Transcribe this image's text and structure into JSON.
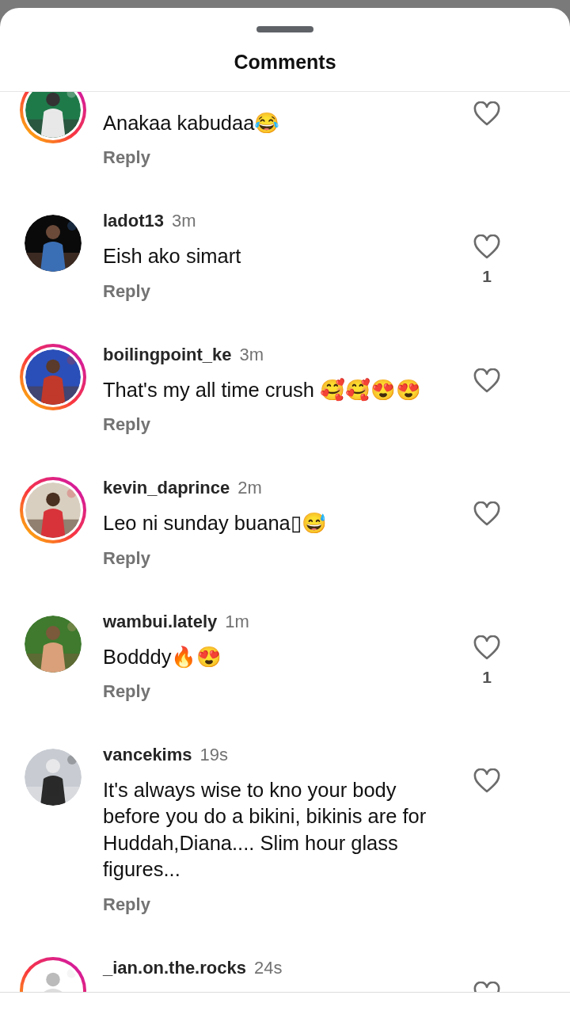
{
  "sheet": {
    "title": "Comments"
  },
  "comments": [
    {
      "text": "Anakaa kabudaa😂",
      "reply": "Reply",
      "has_story": true
    },
    {
      "username": "ladot13",
      "time": "3m",
      "text": "Eish ako simart",
      "reply": "Reply",
      "has_story": false,
      "likes": "1"
    },
    {
      "username": "boilingpoint_ke",
      "time": "3m",
      "text": "That's my all time crush 🥰🥰😍😍",
      "reply": "Reply",
      "has_story": true
    },
    {
      "username": "kevin_daprince",
      "time": "2m",
      "text": "Leo ni sunday buana▯😅",
      "reply": "Reply",
      "has_story": true
    },
    {
      "username": "wambui.lately",
      "time": "1m",
      "text": "Bodddy🔥😍",
      "reply": "Reply",
      "has_story": false,
      "likes": "1"
    },
    {
      "username": "vancekims",
      "time": "19s",
      "text": "It's always wise to kno your body before you do a bikini, bikinis are for Huddah,Diana.... Slim hour glass figures...",
      "reply": "Reply",
      "has_story": false
    },
    {
      "username": "_ian.on.the.rocks",
      "time": "24s",
      "has_story": true
    }
  ]
}
